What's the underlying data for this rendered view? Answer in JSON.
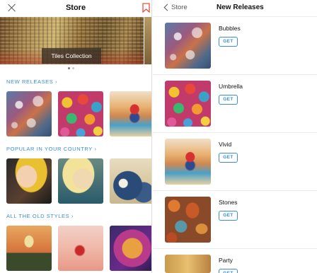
{
  "left_header": {
    "title": "Store"
  },
  "banner": {
    "label": "Tiles Collection"
  },
  "sections": {
    "new_releases": "NEW RELEASES",
    "popular": "POPULAR IN YOUR COUNTRY",
    "old_styles": "ALL THE OLD STYLES"
  },
  "section_arrow": "›",
  "right_header": {
    "back_label": "Store",
    "title": "New Releases"
  },
  "releases": [
    {
      "name": "Bubbles",
      "button": "GET"
    },
    {
      "name": "Umbrella",
      "button": "GET"
    },
    {
      "name": "Vivid",
      "button": "GET"
    },
    {
      "name": "Stones",
      "button": "GET"
    },
    {
      "name": "Party",
      "button": "GET"
    }
  ],
  "colors": {
    "accent": "#3b8ed4",
    "bookmark": "#e8503a"
  }
}
